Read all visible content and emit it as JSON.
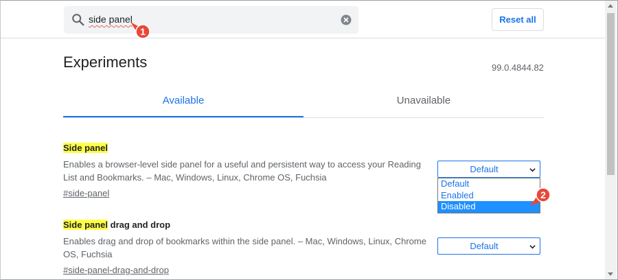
{
  "search": {
    "query": "side panel"
  },
  "header": {
    "reset_label": "Reset all"
  },
  "page": {
    "title": "Experiments",
    "version": "99.0.4844.82"
  },
  "tabs": [
    {
      "label": "Available",
      "active": true
    },
    {
      "label": "Unavailable",
      "active": false
    }
  ],
  "experiments": [
    {
      "title_highlight": "Side panel",
      "title_rest": "",
      "description": "Enables a browser-level side panel for a useful and persistent way to access your Reading List and Bookmarks. – Mac, Windows, Linux, Chrome OS, Fuchsia",
      "link": "#side-panel",
      "selected": "Default"
    },
    {
      "title_highlight": "Side panel",
      "title_rest": " drag and drop",
      "description": "Enables drag and drop of bookmarks within the side panel. – Mac, Windows, Linux, Chrome OS, Fuchsia",
      "link": "#side-panel-drag-and-drop",
      "selected": "Default"
    }
  ],
  "dropdown": {
    "options": [
      "Default",
      "Enabled",
      "Disabled"
    ],
    "highlighted_index": 2
  },
  "annotations": [
    "1",
    "2"
  ],
  "colors": {
    "accent": "#1a73e8",
    "highlight": "#ffff44",
    "marker": "#e8483a",
    "option_selected": "#1e90ff"
  },
  "icons": {
    "search": "search-icon",
    "clear": "clear-icon",
    "chevron": "chevron-down-icon"
  }
}
